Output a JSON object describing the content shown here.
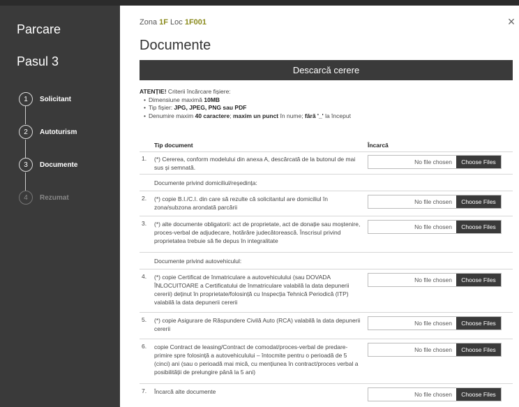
{
  "sidebar": {
    "title": "Parcare",
    "step": "Pasul 3",
    "steps": [
      {
        "num": "1",
        "label": "Solicitant"
      },
      {
        "num": "2",
        "label": "Autoturism"
      },
      {
        "num": "3",
        "label": "Documente"
      },
      {
        "num": "4",
        "label": "Rezumat"
      }
    ]
  },
  "header": {
    "zone_prefix": "Zona ",
    "zone_value": "1F",
    "loc_prefix": " Loc ",
    "loc_value": "1F001",
    "close_glyph": "×",
    "title": "Documente",
    "download_label": "Descarcă cerere"
  },
  "attention": {
    "lead": "ATENȚIE!",
    "lead_text": " Criterii încărcare fișiere:",
    "items": [
      {
        "text": "Dimensiune maximă ",
        "bold": "10MB",
        "tail": ""
      },
      {
        "text": "Tip fișier: ",
        "bold": "JPG, JPEG, PNG sau PDF",
        "tail": ""
      },
      {
        "text": "Denumire maxim ",
        "bold": "40 caractere",
        "mid": "; ",
        "bold2": "maxim un punct",
        "mid2": " în nume; ",
        "bold3": "fără '_'",
        "tail": " la început"
      }
    ]
  },
  "table": {
    "col_doc": "Tip document",
    "col_upload": "Încarcă",
    "no_file": "No file chosen",
    "choose": "Choose Files",
    "rows": [
      {
        "type": "doc",
        "num": "1.",
        "text": "(*) Cererea, conform modelului din anexa A, descărcată de la butonul de mai sus și semnată."
      },
      {
        "type": "section",
        "text": "Documente privind domiciliul/reședința:"
      },
      {
        "type": "doc",
        "num": "2.",
        "text": "(*) copie B.I./C.I. din care să rezulte că solicitantul are domiciliul în zona/subzona arondată parcării"
      },
      {
        "type": "doc",
        "num": "3.",
        "text": "(*) alte documente obligatorii: act de proprietate, act de donație sau moștenire, proces-verbal de adjudecare, hotărâre judecătorească. Înscrisul privind proprietatea trebuie să fie depus în integralitate"
      },
      {
        "type": "section",
        "text": "Documente privind autovehiculul:"
      },
      {
        "type": "doc",
        "num": "4.",
        "text": "(*) copie Certificat de înmatriculare a autovehiculului (sau DOVADA ÎNLOCUITOARE a Certificatului de înmatriculare valabilă la data depunerii cererii) deținut în proprietate/folosință cu Inspecția Tehnică Periodică (ITP) valabilă la data depunerii cererii"
      },
      {
        "type": "doc",
        "num": "5.",
        "text": "(*) copie Asigurare de Răspundere Civilă Auto (RCA) valabilă la data depunerii cererii"
      },
      {
        "type": "doc",
        "num": "6.",
        "text": "copie Contract de leasing/Contract de comodat/proces-verbal de predare-primire spre folosință a autovehiculului – întocmite pentru o perioadă de 5 (cinci) ani (sau o perioadă mai mică, cu mențiunea în contract/proces verbal a posibilității de prelungire până la 5 ani)"
      },
      {
        "type": "doc",
        "num": "7.",
        "text": "Încarcă alte documente"
      }
    ]
  }
}
